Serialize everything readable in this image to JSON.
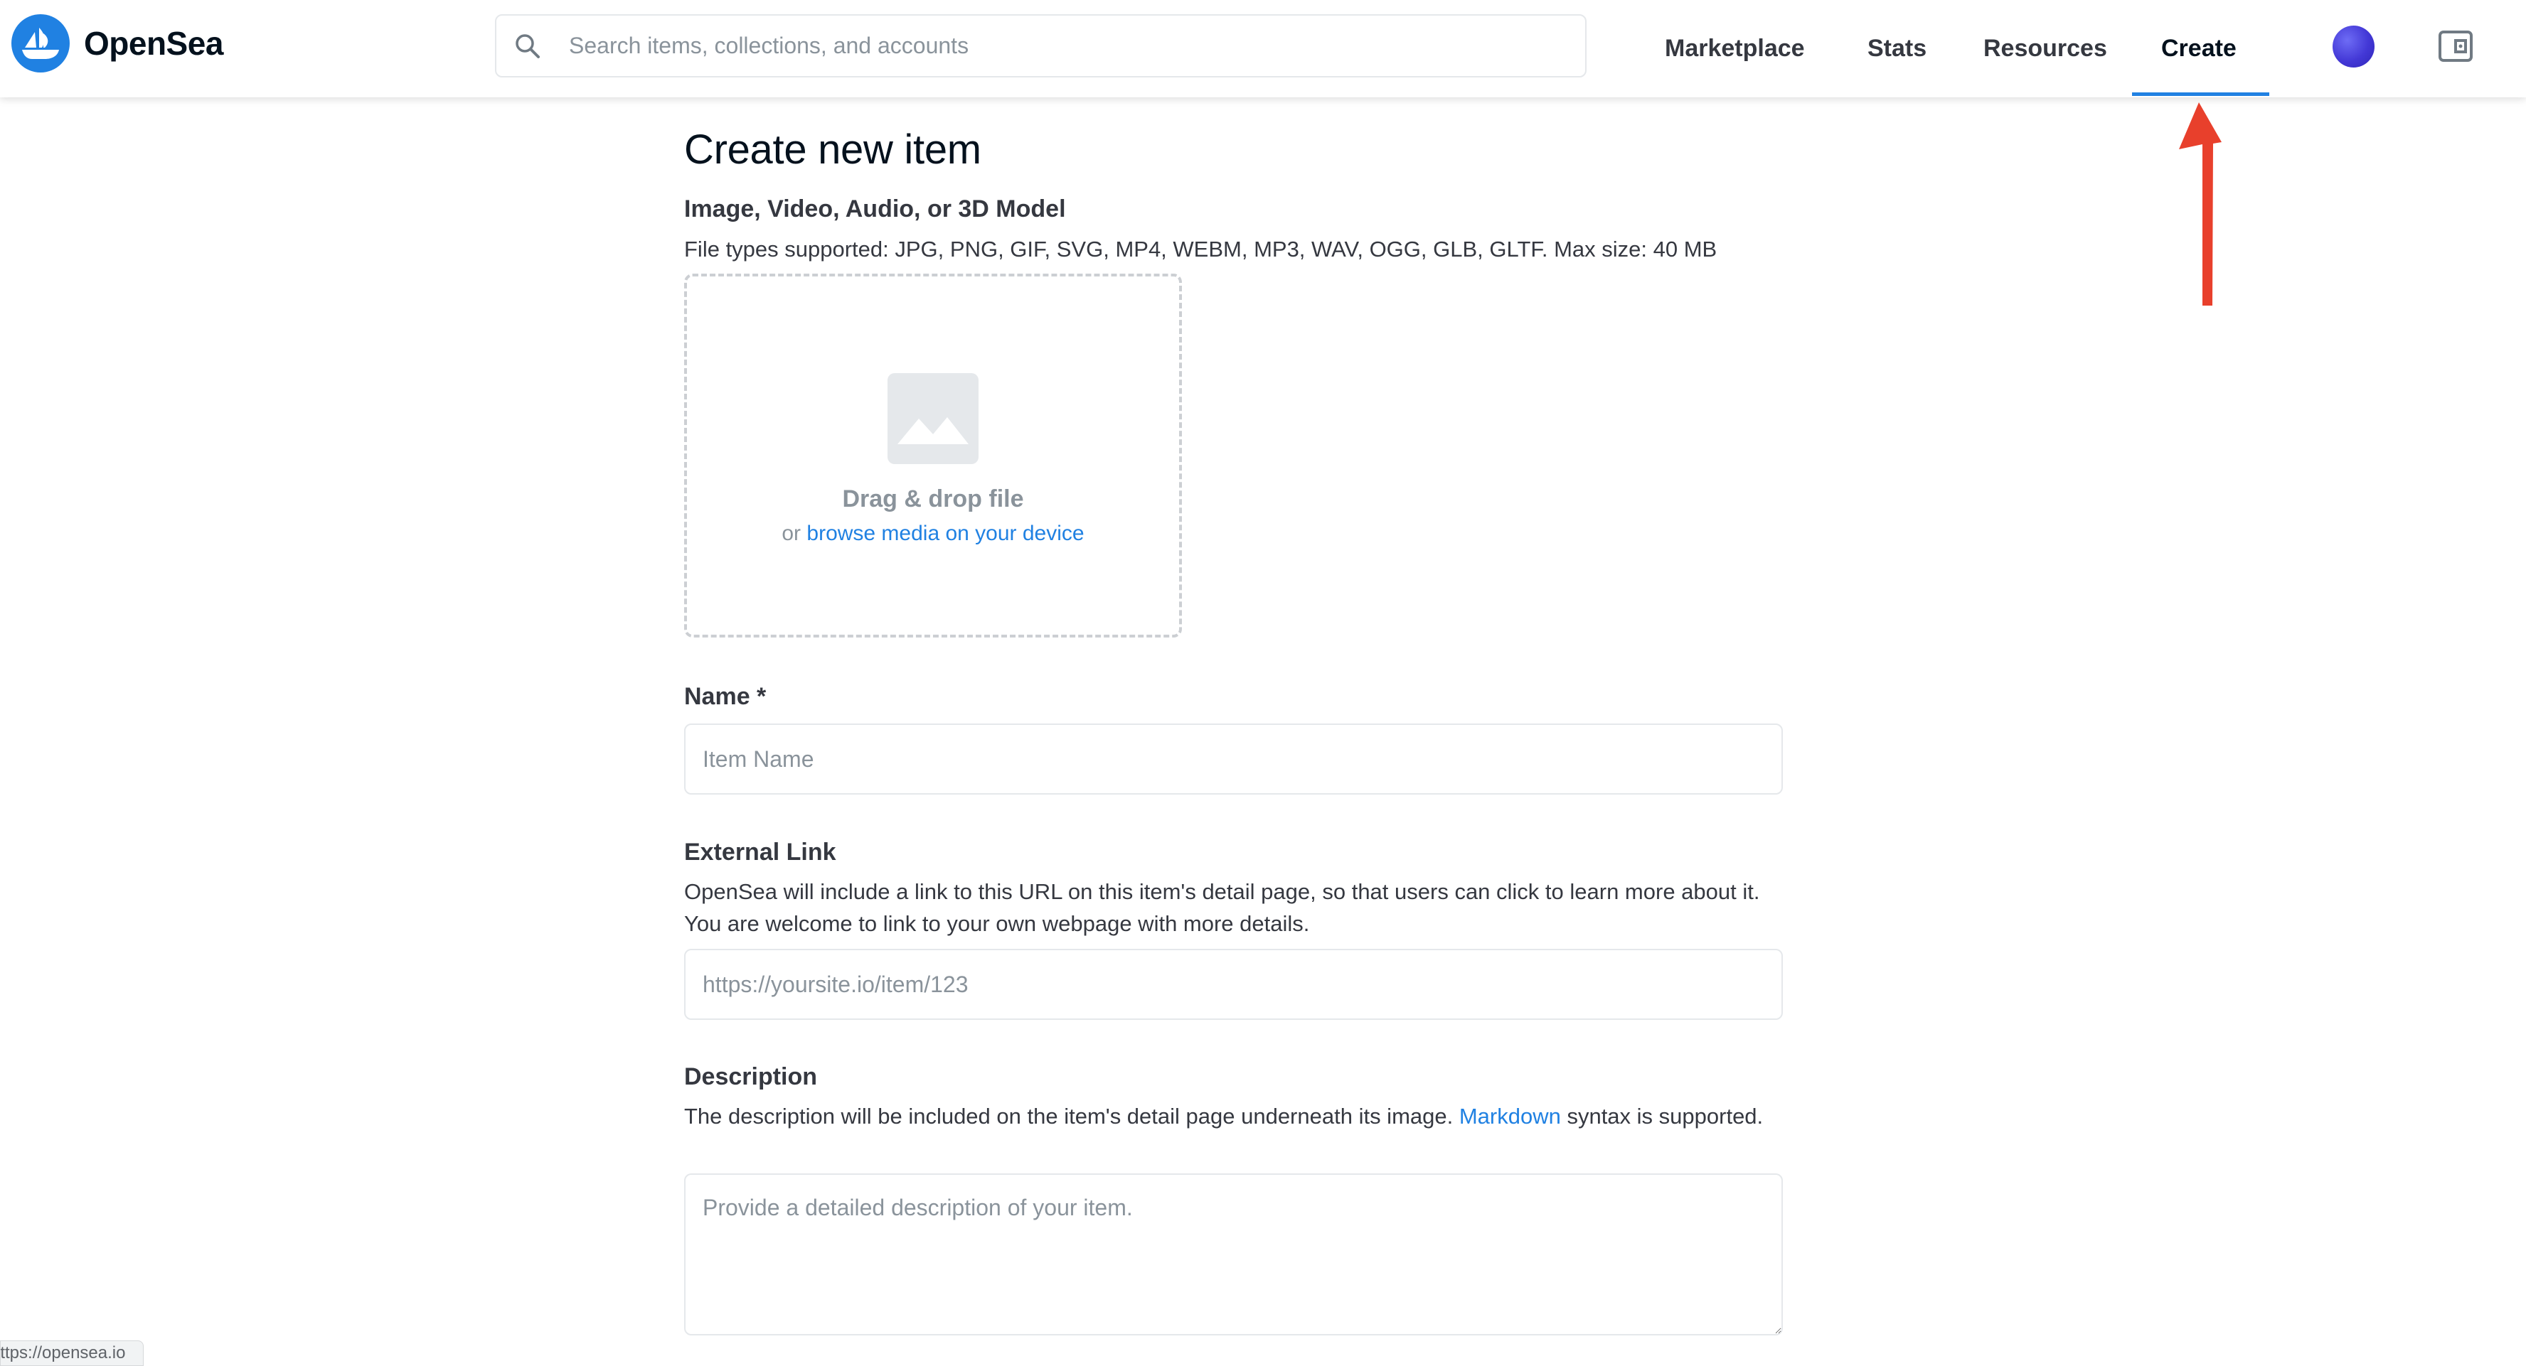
{
  "header": {
    "logo_text": "OpenSea",
    "search_placeholder": "Search items, collections, and accounts",
    "nav": [
      {
        "label": "Marketplace"
      },
      {
        "label": "Stats"
      },
      {
        "label": "Resources"
      },
      {
        "label": "Create",
        "active": true
      }
    ]
  },
  "main": {
    "title": "Create new item",
    "media": {
      "label": "Image, Video, Audio, or 3D Model",
      "help": "File types supported: JPG, PNG, GIF, SVG, MP4, WEBM, MP3, WAV, OGG, GLB, GLTF. Max size: 40 MB",
      "drop_title": "Drag & drop file",
      "drop_or": "or ",
      "drop_link": "browse media on your device"
    },
    "name": {
      "label": "Name *",
      "placeholder": "Item Name"
    },
    "external_link": {
      "label": "External Link",
      "help": "OpenSea will include a link to this URL on this item's detail page, so that users can click to learn more about it. You are welcome to link to your own webpage with more details.",
      "placeholder": "https://yoursite.io/item/123"
    },
    "description": {
      "label": "Description",
      "help_before": "The description will be included on the item's detail page underneath its image. ",
      "help_link": "Markdown",
      "help_after": " syntax is supported.",
      "placeholder": "Provide a detailed description of your item."
    }
  },
  "status_bar": {
    "url": "https://opensea.io"
  },
  "colors": {
    "accent": "#2081e2",
    "annotation_arrow": "#e8402c",
    "avatar": "#4338d6"
  }
}
